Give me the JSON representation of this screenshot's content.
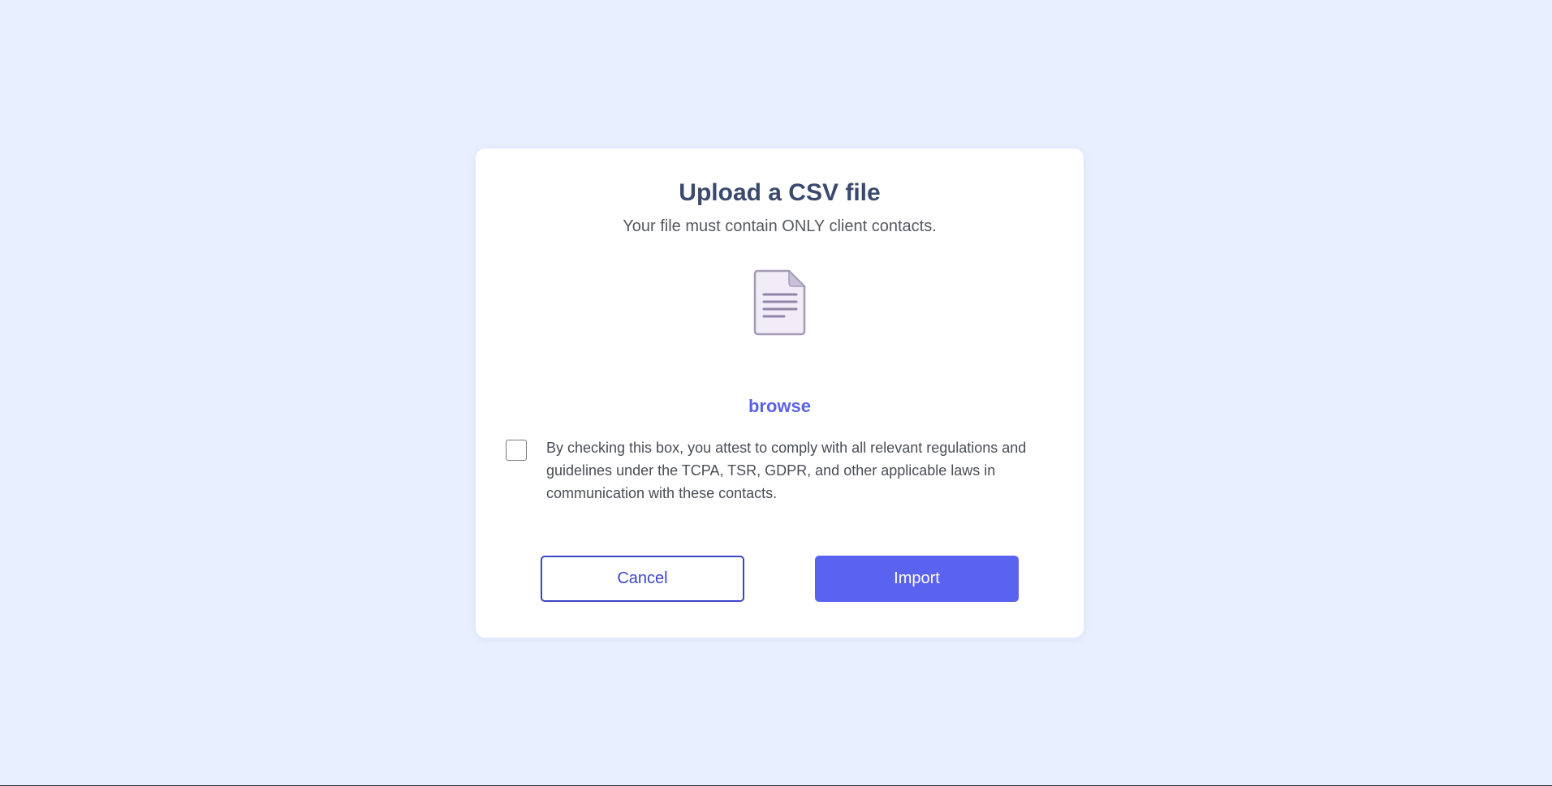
{
  "modal": {
    "title": "Upload a CSV file",
    "subtitle": "Your file must contain ONLY client contacts.",
    "icon": "document-icon",
    "browse_label": "browse",
    "consent": {
      "checked": false,
      "text": "By checking this box, you attest to comply with all relevant regulations and guidelines under the TCPA, TSR, GDPR, and other applicable laws in communication with these contacts."
    },
    "buttons": {
      "cancel_label": "Cancel",
      "import_label": "Import"
    }
  },
  "colors": {
    "page_background": "#e8effe",
    "title": "#3a4a6e",
    "accent": "#5a63f0",
    "cancel_border": "#3d44c7",
    "icon_fill": "#f2ecf8",
    "icon_stroke": "#a59bb8"
  }
}
